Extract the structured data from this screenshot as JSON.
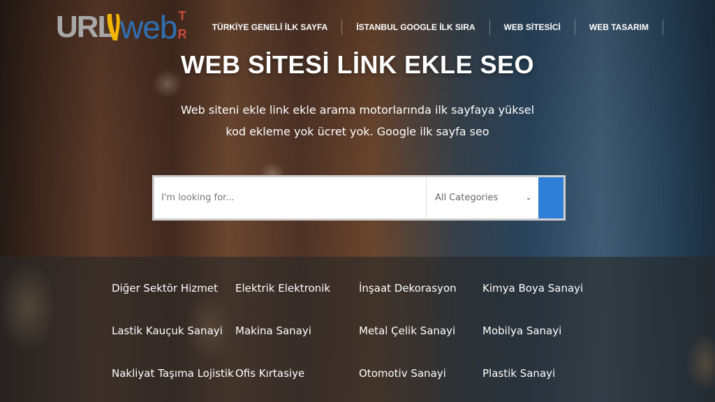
{
  "logo": {
    "url_text": "URL",
    "web_text": "web",
    "tr_letters": [
      "T",
      "R"
    ]
  },
  "nav": {
    "items": [
      {
        "label": "TÜRKİYE GENELİ İLK SAYFA"
      },
      {
        "label": "İSTANBUL GOOGLE İLK SIRA"
      },
      {
        "label": "WEB SİTESİCİ"
      },
      {
        "label": "WEB TASARIM"
      }
    ]
  },
  "hero": {
    "title": "WEB SİTESİ LİNK EKLE SEO",
    "subtitle_line1": "Web siteni ekle link ekle arama motorlarında ilk sayfaya yüksel",
    "subtitle_line2": "kod ekleme yok ücret yok. Google ilk sayfa seo"
  },
  "search": {
    "placeholder": "I'm looking for...",
    "category_selected": "All Categories",
    "button_color": "#2f7fd8"
  },
  "categories": [
    "Diğer Sektör Hizmet",
    "Elektrik Elektronik",
    "İnşaat Dekorasyon",
    "Kimya Boya Sanayi",
    "Lastik Kauçuk Sanayi",
    "Makina Sanayi",
    "Metal Çelik Sanayi",
    "Mobilya Sanayi",
    "Nakliyat Taşıma Lojistik",
    "Ofis Kırtasiye",
    "Otomotiv Sanayi",
    "Plastik Sanayi"
  ],
  "colors": {
    "logo_gray": "#a8a8a8",
    "logo_blue": "#2f6fb3",
    "logo_yellow": "#f2b500",
    "logo_red": "#c94a3a"
  }
}
